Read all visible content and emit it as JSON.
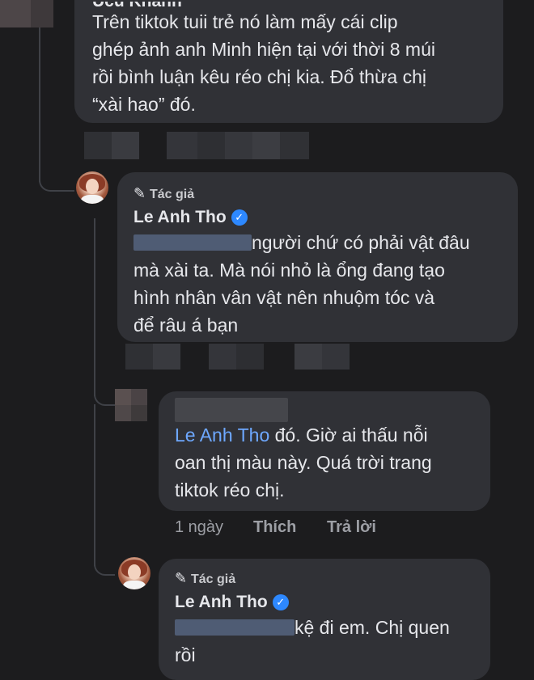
{
  "comment_top": {
    "author_partial": "Ucu Khanh",
    "lines": [
      "Trên tiktok tuii trẻ nó làm mấy cái clip",
      "ghép ảnh anh Minh hiện tại với thời 8 múi",
      "rồi bình luận kêu réo chị kia. Đổ thừa chị",
      "“xài hao” đó."
    ]
  },
  "reply_1": {
    "badge": "Tác giả",
    "author": "Le Anh Tho",
    "verified": true,
    "lines": [
      "người chứ có phải vật đâu",
      "mà xài ta. Mà nói nhỏ là ổng đang tạo",
      "hình nhân vân vật nên nhuộm tóc và",
      "để râu á bạn"
    ]
  },
  "reply_2": {
    "mention": "Le Anh Tho",
    "line1_rest": " đó. Giờ ai thấu nỗi",
    "lines": [
      "oan thị màu này. Quá trời trang",
      "tiktok réo chị."
    ],
    "actions": {
      "time": "1 ngày",
      "like": "Thích",
      "reply": "Trả lời"
    }
  },
  "reply_3": {
    "badge": "Tác giả",
    "author": "Le Anh Tho",
    "verified": true,
    "line1_rest": "kệ đi em. Chị quen",
    "line2": "rồi"
  },
  "colors": {
    "background": "#1c1c1e",
    "bubble": "#303136",
    "mention": "#6ea8ff",
    "verified": "#2d88ff"
  }
}
